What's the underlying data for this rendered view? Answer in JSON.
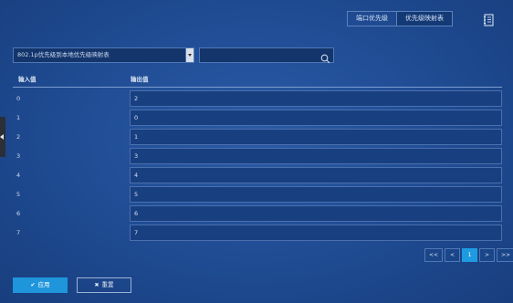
{
  "tabs": [
    {
      "label": "端口优先级",
      "active": false
    },
    {
      "label": "优先级映射表",
      "active": true
    }
  ],
  "header_icon": "notebook-icon",
  "mapping_select": {
    "value": "802.1p优先级到本地优先级映射表"
  },
  "search": {
    "value": "",
    "placeholder": ""
  },
  "table": {
    "headers": {
      "input": "输入值",
      "output": "输出值"
    },
    "rows": [
      {
        "input": "0",
        "output": "2"
      },
      {
        "input": "1",
        "output": "0"
      },
      {
        "input": "2",
        "output": "1"
      },
      {
        "input": "3",
        "output": "3"
      },
      {
        "input": "4",
        "output": "4"
      },
      {
        "input": "5",
        "output": "5"
      },
      {
        "input": "6",
        "output": "6"
      },
      {
        "input": "7",
        "output": "7"
      }
    ]
  },
  "pagination": {
    "first": "<<",
    "prev": "<",
    "current": "1",
    "next": ">",
    "last": ">>"
  },
  "buttons": {
    "apply": "应用",
    "reset": "重置"
  },
  "colors": {
    "accent": "#1f95dc",
    "background": "#1f4b92"
  }
}
